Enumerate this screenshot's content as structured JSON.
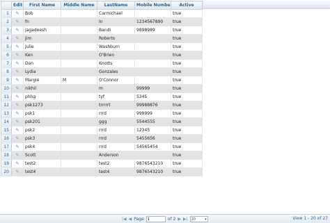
{
  "columns": [
    "Edit",
    "First Name",
    "Middle Name",
    "LastName",
    "Mobile Number",
    "Active"
  ],
  "rows": [
    {
      "n": "1",
      "first": "Bob",
      "middle": "",
      "last": "Carmichael",
      "mobile": "",
      "active": "true"
    },
    {
      "n": "2",
      "first": "fn",
      "middle": "",
      "last": "ln",
      "mobile": "1234567890",
      "active": "true"
    },
    {
      "n": "3",
      "first": "jagadeesh",
      "middle": "",
      "last": "Bandi",
      "mobile": "9898989",
      "active": "true"
    },
    {
      "n": "4",
      "first": "Jim",
      "middle": "",
      "last": "Roberts",
      "mobile": "",
      "active": "true"
    },
    {
      "n": "5",
      "first": "Julie",
      "middle": "",
      "last": "Washburn",
      "mobile": "",
      "active": "true"
    },
    {
      "n": "6",
      "first": "Ken",
      "middle": "",
      "last": "O'Brien",
      "mobile": "",
      "active": "true"
    },
    {
      "n": "7",
      "first": "Dan",
      "middle": "",
      "last": "Knotts",
      "mobile": "",
      "active": "true"
    },
    {
      "n": "8",
      "first": "Lydia",
      "middle": "",
      "last": "Gonzales",
      "mobile": "",
      "active": "true"
    },
    {
      "n": "9",
      "first": "Margie",
      "middle": "M",
      "last": "O'Connor",
      "mobile": "",
      "active": "true"
    },
    {
      "n": "10",
      "first": "nikhil",
      "middle": "",
      "last": "m",
      "mobile": "99999",
      "active": "true"
    },
    {
      "n": "11",
      "first": "phhg",
      "middle": "",
      "last": "tyf",
      "mobile": "5345",
      "active": "true"
    },
    {
      "n": "12",
      "first": "psk1273",
      "middle": "",
      "last": "trrrrrt",
      "mobile": "99988876",
      "active": "true"
    },
    {
      "n": "13",
      "first": "psk1",
      "middle": "",
      "last": "rrrd",
      "mobile": "999999",
      "active": "true"
    },
    {
      "n": "14",
      "first": "psk201",
      "middle": "",
      "last": "ggg",
      "mobile": "5544555",
      "active": "true"
    },
    {
      "n": "15",
      "first": "psk2",
      "middle": "",
      "last": "rrrd",
      "mobile": "12345",
      "active": "true"
    },
    {
      "n": "16",
      "first": "psk3",
      "middle": "",
      "last": "rrrd",
      "mobile": "5455656",
      "active": "true"
    },
    {
      "n": "17",
      "first": "psk4",
      "middle": "",
      "last": "rrrd",
      "mobile": "54565454",
      "active": "true"
    },
    {
      "n": "18",
      "first": "Scott",
      "middle": "",
      "last": "Anderson",
      "mobile": "",
      "active": "true"
    },
    {
      "n": "19",
      "first": "test2",
      "middle": "",
      "last": "test2",
      "mobile": "9876543210",
      "active": "true"
    },
    {
      "n": "20",
      "first": "test4",
      "middle": "",
      "last": "test4",
      "mobile": "9876543210",
      "active": "true"
    }
  ],
  "edit_icon": "pencil-icon",
  "pager": {
    "page_label": "Page",
    "page_value": "1",
    "of_label": "of 2",
    "page_size": "20",
    "info": "View 1 - 20 of 27"
  }
}
